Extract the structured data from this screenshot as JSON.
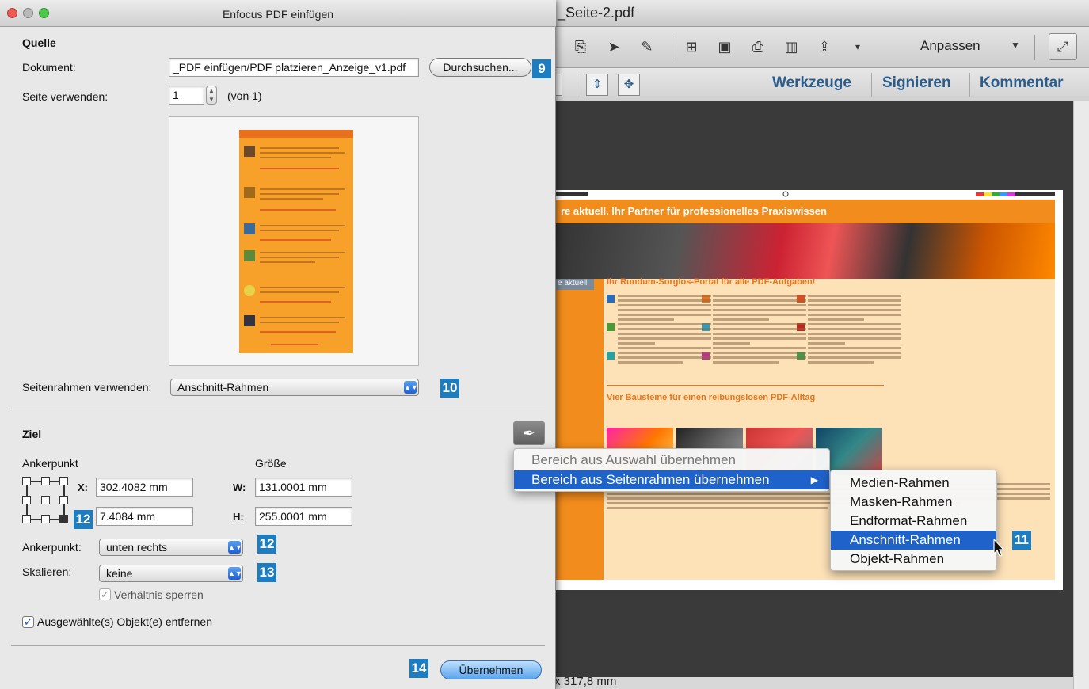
{
  "app": {
    "window_title": "_Seite-2.pdf",
    "toolbar": {
      "customize_label": "Anpassen"
    },
    "task_panes": {
      "tools": "Werkzeuge",
      "sign": "Signieren",
      "comment": "Kommentar"
    },
    "status_text": "x 317,8 mm"
  },
  "pdf_preview": {
    "header_text": "re aktuell. Ihr Partner für professionelles Praxiswissen",
    "side_tag": "e aktuell",
    "heading_1": "Ihr Rundum-Sorglos-Portal für alle PDF-Aufgaben!",
    "heading_2": "Vier Bausteine für einen reibungslosen PDF-Alltag"
  },
  "dialog": {
    "title": "Enfocus PDF einfügen",
    "source": {
      "section_title": "Quelle",
      "document_label": "Dokument:",
      "document_value": "_PDF einfügen/PDF platzieren_Anzeige_v1.pdf",
      "browse_button": "Durchsuchen...",
      "page_label": "Seite verwenden:",
      "page_value": "1",
      "page_of": "(von 1)",
      "page_box_label": "Seitenrahmen verwenden:",
      "page_box_value": "Anschnitt-Rahmen"
    },
    "target": {
      "section_title": "Ziel",
      "anchor_title": "Ankerpunkt",
      "size_title": "Größe",
      "x_label": "X:",
      "x_value": "302.4082 mm",
      "y_value": "7.4084 mm",
      "w_label": "W:",
      "w_value": "131.0001 mm",
      "h_label": "H:",
      "h_value": "255.0001 mm",
      "anchor_label": "Ankerpunkt:",
      "anchor_value": "unten rechts",
      "scale_label": "Skalieren:",
      "scale_value": "keine",
      "lock_ratio_label": "Verhältnis sperren",
      "lock_ratio_checked": true,
      "remove_selected_label": "Ausgewählte(s) Objekt(e) entfernen",
      "remove_selected_checked": true
    },
    "apply_button": "Übernehmen"
  },
  "context_menu": {
    "items": [
      {
        "label": "Bereich aus Auswahl übernehmen",
        "enabled": false
      },
      {
        "label": "Bereich aus Seitenrahmen übernehmen",
        "enabled": true,
        "highlighted": true,
        "has_submenu": true
      }
    ],
    "submenu": [
      {
        "label": "Medien-Rahmen"
      },
      {
        "label": "Masken-Rahmen"
      },
      {
        "label": "Endformat-Rahmen"
      },
      {
        "label": "Anschnitt-Rahmen",
        "highlighted": true
      },
      {
        "label": "Objekt-Rahmen"
      }
    ]
  },
  "callouts": {
    "b9": "9",
    "b10": "10",
    "b11": "11",
    "b12a": "12",
    "b12b": "12",
    "b13": "13",
    "b14": "14"
  },
  "colors": {
    "callout_badge": "#1e7dc0",
    "menu_highlight": "#1f62c9",
    "task_pane_link": "#2a5d8c",
    "pdf_orange": "#f28c1c"
  },
  "icons": {
    "submenu_arrow": "triangle-right-icon",
    "eyedropper": "eyedropper-icon",
    "checkmark": "checkmark-icon"
  }
}
